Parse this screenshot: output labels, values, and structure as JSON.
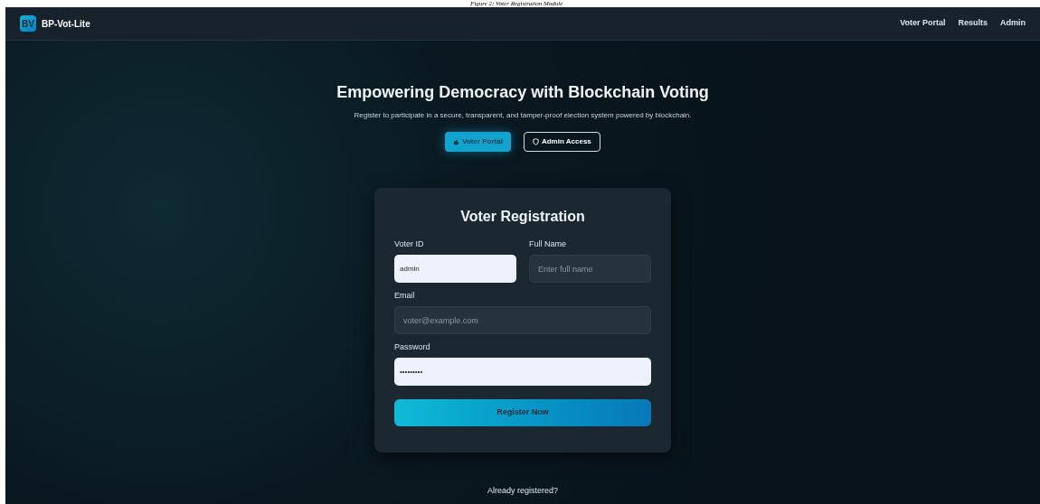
{
  "caption": "Figure 2: Voter Registration Module",
  "navbar": {
    "logo": "BV",
    "brand": "BP-Vot-Lite",
    "links": [
      "Voter Portal",
      "Results",
      "Admin"
    ]
  },
  "hero": {
    "title": "Empowering Democracy with Blockchain Voting",
    "subtitle": "Register to participate in a secure, transparent, and tamper-proof election system powered by blockchain.",
    "buttons": [
      {
        "label": "Voter Portal",
        "selected": true
      },
      {
        "label": "Admin Access",
        "selected": false
      }
    ]
  },
  "form": {
    "title": "Voter Registration",
    "fields": [
      {
        "label": "Voter ID",
        "value": "admin"
      },
      {
        "label": "Full Name",
        "placeholder": "Enter full name"
      },
      {
        "label": "Email",
        "placeholder": "voter@example.com"
      },
      {
        "label": "Password",
        "value": "•••••••••"
      }
    ],
    "submit": "Register Now"
  },
  "footer_text": "Already registered?"
}
